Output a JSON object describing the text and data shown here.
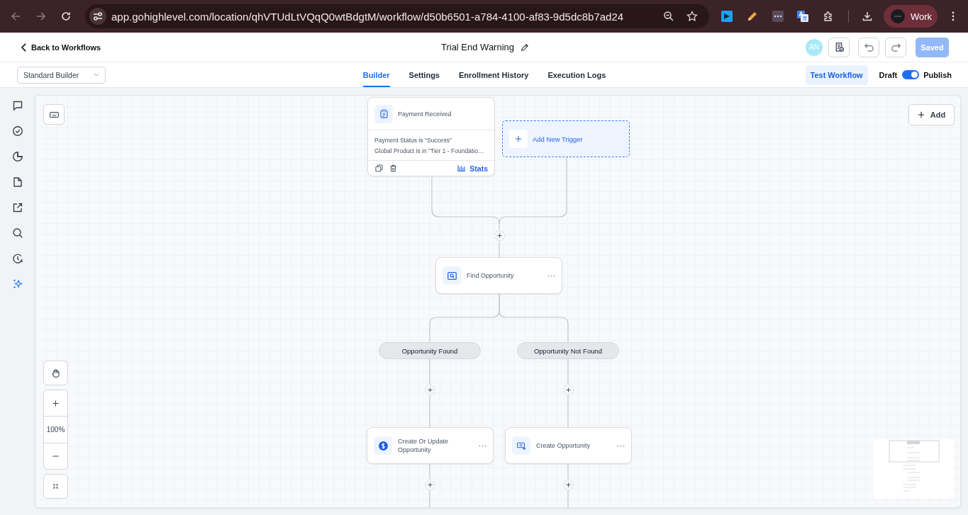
{
  "browser": {
    "url": "app.gohighlevel.com/location/qhVTUdLtVQqQ0wtBdgtM/workflow/d50b6501-a784-4100-af83-9d5dc8b7ad24",
    "profile": "Work"
  },
  "header": {
    "back_link": "Back to Workflows",
    "title": "Trial End Warning",
    "avatar": "AN",
    "save_button": {
      "label": "Saved",
      "disabled": true
    }
  },
  "builder_select": {
    "value": "Standard Builder"
  },
  "tabs": [
    {
      "label": "Builder",
      "selected": true
    },
    {
      "label": "Settings",
      "selected": false
    },
    {
      "label": "Enrollment History",
      "selected": false
    },
    {
      "label": "Execution Logs",
      "selected": false
    }
  ],
  "test_button": "Test Workflow",
  "publish_switch": {
    "off_label": "Draft",
    "on_label": "Publish",
    "on": true
  },
  "canvas": {
    "add_button": "Add",
    "trigger": {
      "title": "Payment Received",
      "conditions": [
        "Payment Status is \"Success\"",
        "Global Product is in \"Tier 1 - Foundatio…"
      ],
      "stats": "Stats"
    },
    "add_trigger": "Add New Trigger",
    "action": {
      "kind": "find",
      "label": "Find Opportunity"
    },
    "branches": [
      {
        "label": "Opportunity Found",
        "action": {
          "kind": "dollar",
          "label": "Create Or Update Opportunity"
        }
      },
      {
        "label": "Opportunity Not Found",
        "action": {
          "kind": "create",
          "label": "Create Opportunity"
        }
      }
    ],
    "zoom_level": "100%"
  }
}
